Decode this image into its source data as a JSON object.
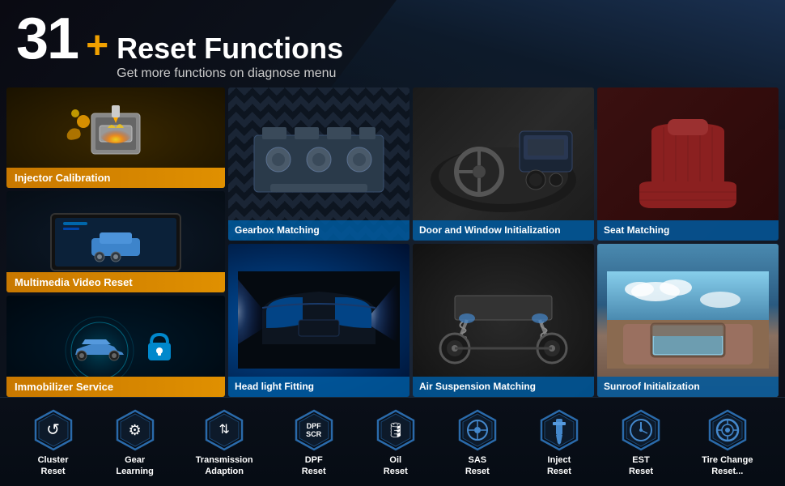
{
  "header": {
    "number": "31",
    "plus": "+",
    "title": "Reset Functions",
    "subtitle": "Get more functions on diagnose menu"
  },
  "left_cards": [
    {
      "id": "injector-calibration",
      "label": "Injector Calibration",
      "emoji": "🔧"
    },
    {
      "id": "multimedia-video-reset",
      "label": "Multimedia Video Reset",
      "emoji": "📺"
    },
    {
      "id": "immobilizer-service",
      "label": "Immobilizer Service",
      "emoji": "🔒"
    }
  ],
  "grid_cards": [
    {
      "id": "gearbox-matching",
      "label": "Gearbox Matching",
      "emoji": "⚙️"
    },
    {
      "id": "door-window-init",
      "label": "Door and Window Initialization",
      "emoji": "🚗"
    },
    {
      "id": "seat-matching",
      "label": "Seat Matching",
      "emoji": "💺"
    },
    {
      "id": "headlight-fitting",
      "label": "Head light Fitting",
      "emoji": "💡"
    },
    {
      "id": "air-suspension-matching",
      "label": "Air Suspension Matching",
      "emoji": "🔩"
    },
    {
      "id": "sunroof-initialization",
      "label": "Sunroof Initialization",
      "emoji": "☀️"
    }
  ],
  "bottom_items": [
    {
      "id": "cluster-reset",
      "label": "Cluster\nReset",
      "symbol": "↺",
      "hex_color": "#1a3a5a"
    },
    {
      "id": "gear-learning",
      "label": "Gear\nLearning",
      "symbol": "⚙",
      "hex_color": "#1a3a5a"
    },
    {
      "id": "transmission-adaption",
      "label": "Transmission\nAdaption",
      "symbol": "⇅",
      "hex_color": "#1a3a5a"
    },
    {
      "id": "dpf-reset",
      "label": "DPF\nReset",
      "symbol": "DPF\nSCR",
      "hex_color": "#1a3a5a",
      "small_text": true
    },
    {
      "id": "oil-reset",
      "label": "Oil\nReset",
      "symbol": "🛢",
      "hex_color": "#1a3a5a"
    },
    {
      "id": "sas-reset",
      "label": "SAS\nReset",
      "symbol": "⊙",
      "hex_color": "#1a3a5a"
    },
    {
      "id": "inject-reset",
      "label": "Inject\nReset",
      "symbol": "⊥",
      "hex_color": "#1a3a5a"
    },
    {
      "id": "est-reset",
      "label": "EST\nReset",
      "symbol": "⏱",
      "hex_color": "#1a3a5a"
    },
    {
      "id": "tire-change-reset",
      "label": "Tire Change\nReset...",
      "symbol": "◎",
      "hex_color": "#1a3a5a"
    }
  ]
}
